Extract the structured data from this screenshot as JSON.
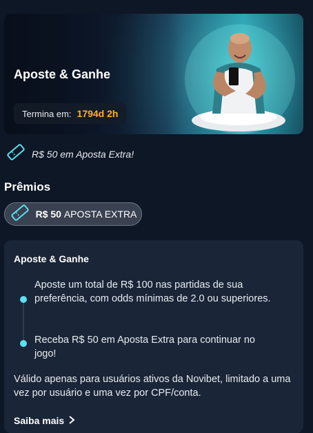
{
  "banner": {
    "title": "Aposte & Ganhe",
    "timer_label": "Termina em:",
    "timer_value": "1794d 2h"
  },
  "extra_bet": {
    "icon": "ticket-icon",
    "text": "R$ 50 em Aposta Extra!"
  },
  "prizes": {
    "title": "Prêmios",
    "pill_amount": "R$ 50",
    "pill_label": "APOSTA EXTRA",
    "pill_icon": "ticket-icon"
  },
  "card": {
    "title": "Aposte & Ganhe",
    "steps": [
      {
        "text": "Aposte um total de R$ 100 nas partidas de sua preferência, com odds mínimas de 2.0 ou superiores."
      },
      {
        "text": "Receba R$ 50 em Aposta Extra para continuar no jogo!"
      }
    ],
    "note": "Válido apenas para usuários ativos da Novibet, limitado a uma vez por usuário e uma vez por CPF/conta.",
    "more_label": "Saiba mais"
  },
  "colors": {
    "background": "#0e1726",
    "card": "#1a2537",
    "accent_cyan": "#5ce1f0",
    "timer_orange": "#ffb020"
  }
}
